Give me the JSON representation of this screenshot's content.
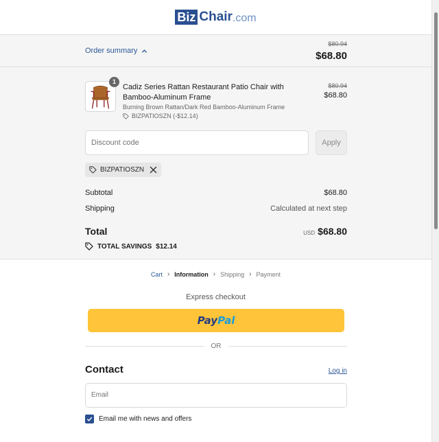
{
  "brand": {
    "logo_biz": "Biz",
    "logo_chair": "Chair",
    "logo_com": ".com",
    "logo_tm": "®"
  },
  "summary": {
    "toggle_label": "Order summary",
    "compare_total": "$80.94",
    "total": "$68.80"
  },
  "product": {
    "quantity": "1",
    "title": "Cadiz Series Rattan Restaurant Patio Chair with Bamboo-Aluminum Frame",
    "variant": "Burning Brown Rattan/Dark Red Bamboo-Aluminum Frame",
    "discount": "BIZPATIOSZN (-$12.14)",
    "compare_price": "$80.94",
    "price": "$68.80"
  },
  "discount": {
    "placeholder": "Discount code",
    "apply_label": "Apply",
    "applied_code": "BIZPATIOSZN"
  },
  "totals": {
    "subtotal_label": "Subtotal",
    "subtotal_value": "$68.80",
    "shipping_label": "Shipping",
    "shipping_value": "Calculated at next step",
    "total_label": "Total",
    "currency": "USD",
    "total_value": "$68.80",
    "savings_label": "TOTAL SAVINGS",
    "savings_value": "$12.14"
  },
  "breadcrumb": {
    "cart": "Cart",
    "information": "Information",
    "shipping": "Shipping",
    "payment": "Payment"
  },
  "checkout": {
    "express_label": "Express checkout",
    "paypal_part1": "Pay",
    "paypal_part2": "Pal",
    "or_label": "OR"
  },
  "contact": {
    "title": "Contact",
    "login_label": "Log in",
    "email_placeholder": "Email",
    "newsletter_label": "Email me with news and offers",
    "newsletter_checked": true
  },
  "colors": {
    "brand_blue": "#2a4f91",
    "link_blue": "#2a5797",
    "paypal_yellow": "#ffc439",
    "summary_bg": "#f5f5f5"
  }
}
